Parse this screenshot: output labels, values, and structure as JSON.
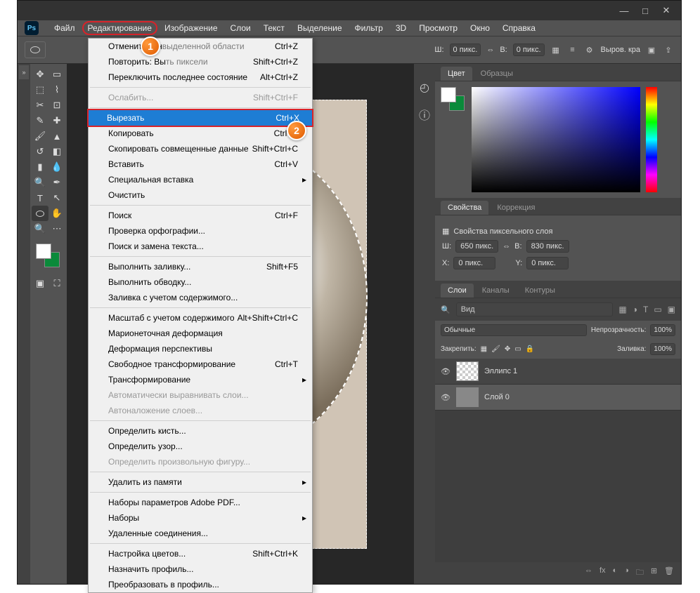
{
  "menubar": {
    "file": "Файл",
    "edit": "Редактирование",
    "image": "Изображение",
    "layer": "Слои",
    "type": "Текст",
    "select": "Выделение",
    "filter": "Фильтр",
    "threeD": "3D",
    "view": "Просмотр",
    "window": "Окно",
    "help": "Справка"
  },
  "badges": {
    "b1": "1",
    "b2": "2"
  },
  "optbar": {
    "w_label": "Ш:",
    "w_val": "0 пикс.",
    "h_label": "В:",
    "h_val": "0 пикс.",
    "align": "Выров. кра"
  },
  "dropdown": {
    "undo": "Отменить: Ин",
    "undo_rest": "выделенной области",
    "undo_sc": "Ctrl+Z",
    "redo": "Повторить: Вы",
    "redo_rest": "ть пиксели",
    "redo_sc": "Shift+Ctrl+Z",
    "toggle": "Переключить последнее состояние",
    "toggle_sc": "Alt+Ctrl+Z",
    "fade": "Ослабить...",
    "fade_sc": "Shift+Ctrl+F",
    "cut": "Вырезать",
    "cut_sc": "Ctrl+X",
    "copy": "Копировать",
    "copy_sc": "Ctrl+C",
    "copymerged": "Скопировать совмещенные данные",
    "copymerged_sc": "Shift+Ctrl+C",
    "paste": "Вставить",
    "paste_sc": "Ctrl+V",
    "pastespecial": "Специальная вставка",
    "clear": "Очистить",
    "search": "Поиск",
    "search_sc": "Ctrl+F",
    "spell": "Проверка орфографии...",
    "findtext": "Поиск и замена текста...",
    "fill": "Выполнить заливку...",
    "fill_sc": "Shift+F5",
    "stroke": "Выполнить обводку...",
    "contentfill": "Заливка с учетом содержимого...",
    "contentscale": "Масштаб с учетом содержимого",
    "contentscale_sc": "Alt+Shift+Ctrl+C",
    "puppet": "Марионеточная деформация",
    "perspective": "Деформация перспективы",
    "freetrans": "Свободное трансформирование",
    "freetrans_sc": "Ctrl+T",
    "transform": "Трансформирование",
    "autoalign": "Автоматически выравнивать слои...",
    "autoblend": "Автоналожение слоев...",
    "brush": "Определить кисть...",
    "pattern": "Определить узор...",
    "shape": "Определить произвольную фигуру...",
    "purge": "Удалить из памяти",
    "pdf": "Наборы параметров Adobe PDF...",
    "presets": "Наборы",
    "remote": "Удаленные соединения...",
    "colorsettings": "Настройка цветов...",
    "colorsettings_sc": "Shift+Ctrl+K",
    "assign": "Назначить профиль...",
    "convert": "Преобразовать в профиль..."
  },
  "panels": {
    "color": "Цвет",
    "swatches": "Образцы",
    "properties": "Свойства",
    "adjustments": "Коррекция",
    "pixel_layer": "Свойства пиксельного слоя",
    "w": "Ш:",
    "w_val": "650 пикс.",
    "h": "В:",
    "h_val": "830 пикс.",
    "x": "X:",
    "x_val": "0 пикс.",
    "y": "Y:",
    "y_val": "0 пикс.",
    "layers": "Слои",
    "channels": "Каналы",
    "paths": "Контуры",
    "kind": "Вид",
    "blend": "Обычные",
    "opacity_l": "Непрозрачность:",
    "opacity_v": "100%",
    "lock": "Закрепить:",
    "fill_l": "Заливка:",
    "fill_v": "100%",
    "layer1": "Эллипс 1",
    "layer2": "Слой 0"
  }
}
